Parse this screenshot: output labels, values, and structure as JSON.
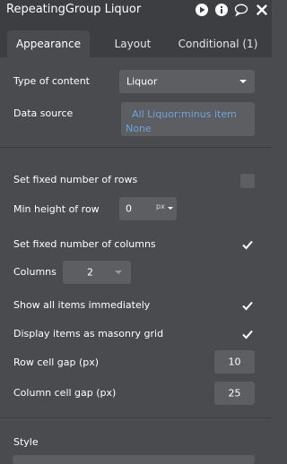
{
  "header": {
    "title": "RepeatingGroup Liquor"
  },
  "tabs": [
    {
      "label": "Appearance",
      "active": true
    },
    {
      "label": "Layout",
      "active": false
    },
    {
      "label": "Conditional (1)",
      "active": false
    }
  ],
  "content": {
    "type_of_content_label": "Type of content",
    "type_of_content_value": "Liquor",
    "data_source_label": "Data source",
    "data_source_line1": "All Liquor:minus item",
    "data_source_line2": "None",
    "fixed_rows_label": "Set fixed number of rows",
    "fixed_rows_checked": false,
    "min_height_label": "Min height of row",
    "min_height_value": "0",
    "min_height_unit": "px",
    "fixed_cols_label": "Set fixed number of columns",
    "fixed_cols_checked": true,
    "columns_label": "Columns",
    "columns_value": "2",
    "show_all_label": "Show all items immediately",
    "show_all_checked": true,
    "masonry_label": "Display items as masonry grid",
    "masonry_checked": true,
    "row_gap_label": "Row cell gap (px)",
    "row_gap_value": "10",
    "col_gap_label": "Column cell gap (px)",
    "col_gap_value": "25",
    "style_label": "Style"
  },
  "colors": {
    "panel_bg": "#4a4b4e",
    "header_bg": "#3d3e41",
    "field_bg": "#5d5e61",
    "link_blue": "#6aa6e0"
  }
}
